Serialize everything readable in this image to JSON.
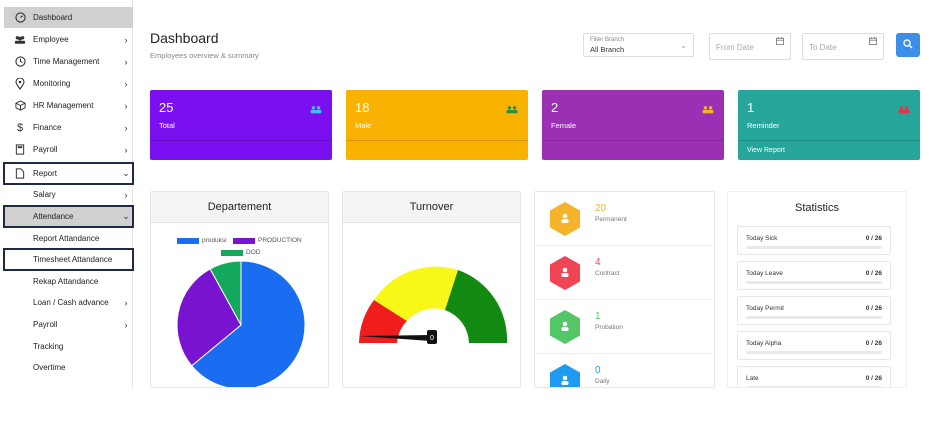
{
  "sidebar": {
    "items": [
      {
        "label": "Dashboard",
        "icon": "speedometer-icon"
      },
      {
        "label": "Employee",
        "icon": "users-icon"
      },
      {
        "label": "Time Management",
        "icon": "clock-icon"
      },
      {
        "label": "Monitoring",
        "icon": "location-pin-icon"
      },
      {
        "label": "HR Management",
        "icon": "cube-icon"
      },
      {
        "label": "Finance",
        "icon": "dollar-icon"
      },
      {
        "label": "Payroll",
        "icon": "calculator-icon"
      },
      {
        "label": "Report",
        "icon": "document-icon"
      },
      {
        "label": "Salary"
      },
      {
        "label": "Attendance"
      },
      {
        "label": "Report Attandance"
      },
      {
        "label": "Timesheet Attandance"
      },
      {
        "label": "Rekap Attandance"
      },
      {
        "label": "Loan / Cash advance"
      },
      {
        "label": "Payroll"
      },
      {
        "label": "Tracking"
      },
      {
        "label": "Overtime"
      }
    ]
  },
  "header": {
    "title": "Dashboard",
    "subtitle": "Employees overview & summary",
    "branch_caption": "Filter Branch",
    "branch_value": "All Branch",
    "from_placeholder": "From Date",
    "to_placeholder": "To Date"
  },
  "cards": [
    {
      "value": "25",
      "label": "Total",
      "color": "#7a0ff0"
    },
    {
      "value": "18",
      "label": "Male",
      "color": "#fab201"
    },
    {
      "value": "2",
      "label": "Female",
      "color": "#9b30b5"
    },
    {
      "value": "1",
      "label": "Reminder",
      "footer": "View Report",
      "color": "#26a69a"
    }
  ],
  "panels": {
    "department_title": "Departement",
    "turnover_title": "Turnover",
    "statistics_title": "Statistics"
  },
  "chart_data": {
    "type": "pie",
    "series": [
      {
        "name": "produksi",
        "value": 64,
        "color": "#1a6cf0"
      },
      {
        "name": "PRODUCTION",
        "value": 28,
        "color": "#7814cf"
      },
      {
        "name": "DOD",
        "value": 8,
        "color": "#14a85c"
      }
    ]
  },
  "gauge": {
    "value": "0",
    "colors": [
      "#f01d1d",
      "#f8f818",
      "#128a12"
    ]
  },
  "employee_status": [
    {
      "count": "20",
      "label": "Permanent",
      "color": "#f5b42c"
    },
    {
      "count": "4",
      "label": "Contract",
      "color": "#ef4555"
    },
    {
      "count": "1",
      "label": "Probation",
      "color": "#53c667"
    },
    {
      "count": "0",
      "label": "Daily",
      "color": "#1e9af0"
    }
  ],
  "statistics": [
    {
      "label": "Today Sick",
      "value": "0 / 26"
    },
    {
      "label": "Today Leave",
      "value": "0 / 26"
    },
    {
      "label": "Today Permit",
      "value": "0 / 26"
    },
    {
      "label": "Today Alpha",
      "value": "0 / 26"
    },
    {
      "label": "Late",
      "value": "0 / 26"
    }
  ]
}
